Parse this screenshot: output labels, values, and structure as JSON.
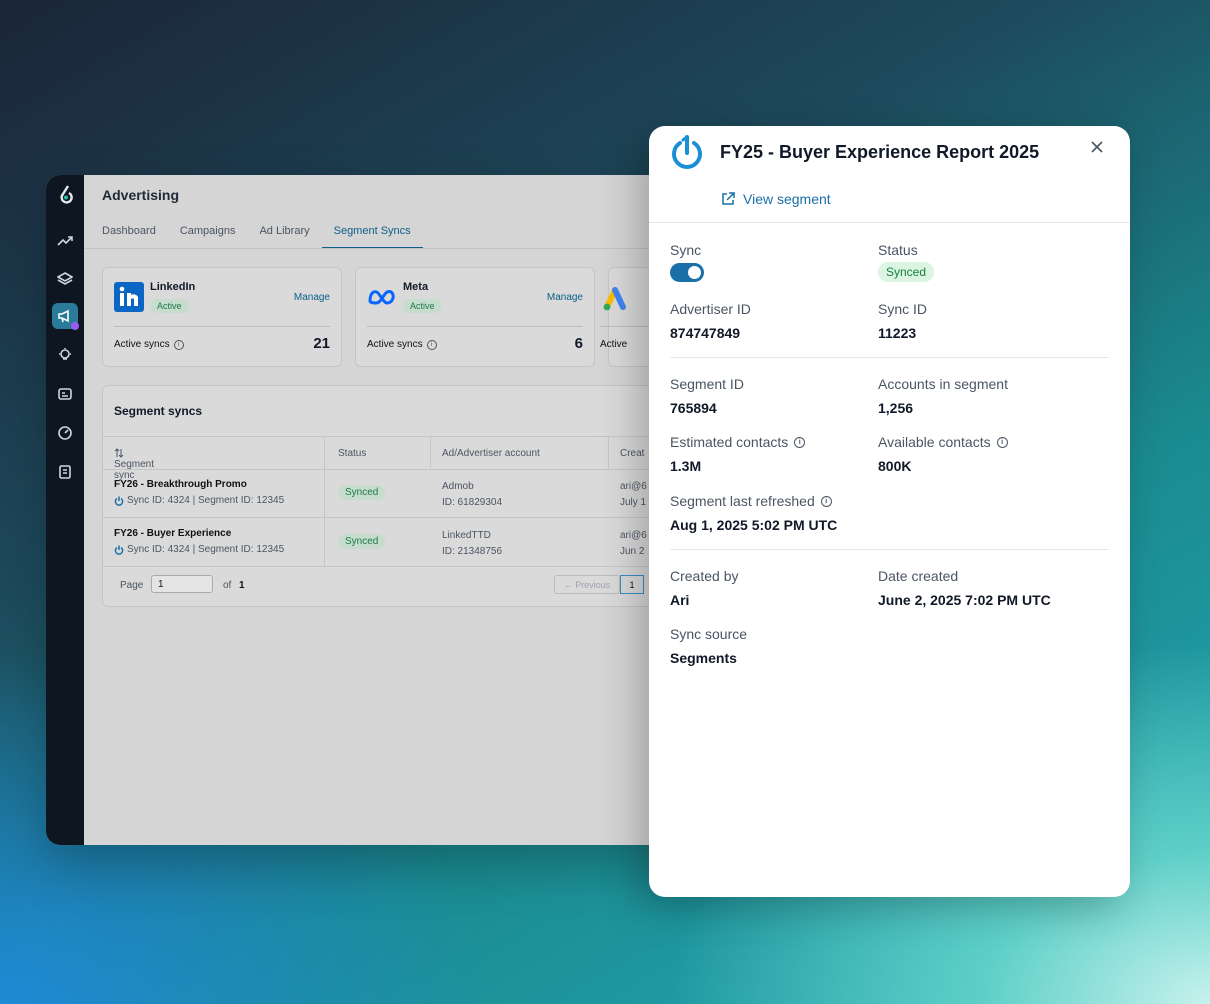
{
  "app": {
    "title": "Advertising",
    "tabs": [
      {
        "label": "Dashboard"
      },
      {
        "label": "Campaigns"
      },
      {
        "label": "Ad Library"
      },
      {
        "label": "Segment Syncs"
      }
    ],
    "active_tab": "Segment Syncs"
  },
  "cards": [
    {
      "name": "LinkedIn",
      "status": "Active",
      "manage": "Manage",
      "active_syncs_label": "Active syncs",
      "count": "21"
    },
    {
      "name": "Meta",
      "status": "Active",
      "manage": "Manage",
      "active_syncs_label": "Active syncs",
      "count": "6"
    },
    {
      "active_syncs_label": "Active"
    }
  ],
  "table": {
    "title": "Segment syncs",
    "columns": [
      "Segment sync",
      "Status",
      "Ad/Advertiser account",
      "Creat"
    ],
    "rows": [
      {
        "name": "FY26 - Breakthrough Promo",
        "ids": "Sync ID: 4324 | Segment ID: 12345",
        "status": "Synced",
        "account": "Admob",
        "account_id": "ID: 61829304",
        "created_by": "ari@6",
        "created": "July 1"
      },
      {
        "name": "FY26 - Buyer Experience",
        "ids": "Sync ID: 4324 | Segment ID: 12345",
        "status": "Synced",
        "account": "LinkedTTD",
        "account_id": "ID: 21348756",
        "created_by": "ari@6",
        "created": "Jun 2"
      }
    ],
    "pager": {
      "page_label": "Page",
      "page_value": "1",
      "of_label": "of",
      "total": "1",
      "prev_label": "Previous",
      "current": "1"
    }
  },
  "panel": {
    "title": "FY25 - Buyer Experience Report 2025",
    "view_segment": "View segment",
    "sync_label": "Sync",
    "sync_on": true,
    "status_label": "Status",
    "status_value": "Synced",
    "advertiser_id_label": "Advertiser ID",
    "advertiser_id": "874747849",
    "sync_id_label": "Sync ID",
    "sync_id": "11223",
    "segment_id_label": "Segment ID",
    "segment_id": "765894",
    "accounts_label": "Accounts in segment",
    "accounts": "1,256",
    "est_contacts_label": "Estimated contacts",
    "est_contacts": "1.3M",
    "avail_contacts_label": "Available contacts",
    "avail_contacts": "800K",
    "refreshed_label": "Segment last refreshed",
    "refreshed": "Aug 1, 2025 5:02 PM UTC",
    "created_by_label": "Created by",
    "created_by": "Ari",
    "date_created_label": "Date created",
    "date_created": "June 2, 2025 7:02 PM UTC",
    "sync_source_label": "Sync source",
    "sync_source": "Segments"
  },
  "colors": {
    "accent": "#1b6fa8",
    "synced_text": "#15803d",
    "synced_bg": "#dcf5e3",
    "rail": "#0e1622"
  }
}
